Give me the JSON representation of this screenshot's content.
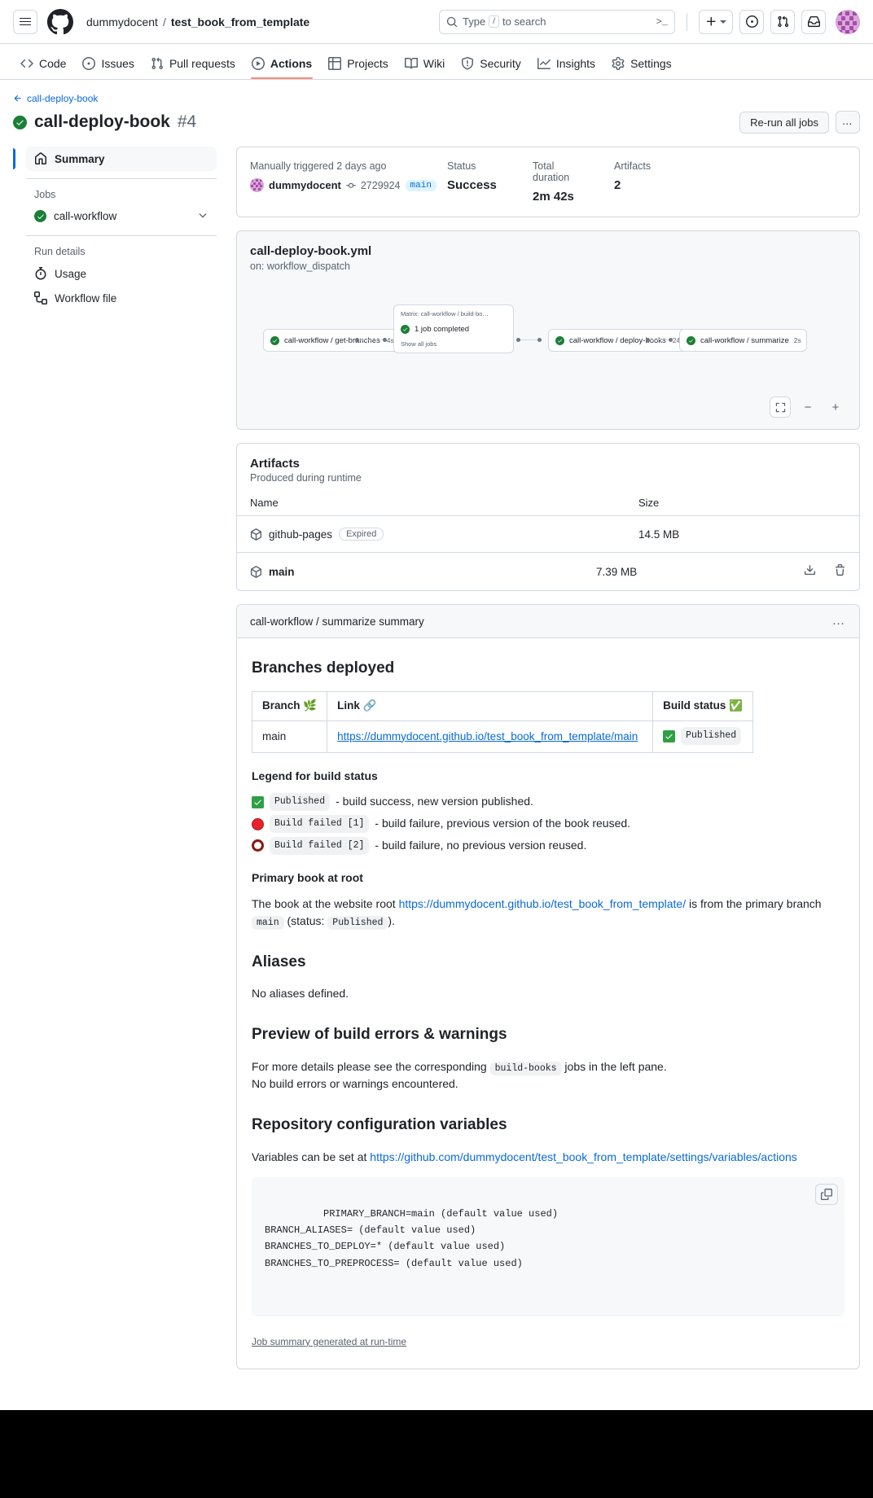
{
  "header": {
    "menu_label": "Open menu",
    "logo_name": "github-logo",
    "owner": "dummydocent",
    "separator": "/",
    "repo": "test_book_from_template",
    "search": {
      "placeholder": "Type",
      "slash_key": "/",
      "placeholder_tail": "to search",
      "command_glyph": ">_"
    },
    "create_label": "+",
    "icons": {
      "issues": "issue-opened-icon",
      "pull_requests": "git-pull-request-icon",
      "inbox": "inbox-icon",
      "avatar": "user-avatar"
    }
  },
  "repo_nav": [
    {
      "label": "Code",
      "icon": "code-icon",
      "active": false
    },
    {
      "label": "Issues",
      "icon": "issue-opened-icon",
      "active": false
    },
    {
      "label": "Pull requests",
      "icon": "git-pull-request-icon",
      "active": false
    },
    {
      "label": "Actions",
      "icon": "play-icon",
      "active": true
    },
    {
      "label": "Projects",
      "icon": "table-icon",
      "active": false
    },
    {
      "label": "Wiki",
      "icon": "book-icon",
      "active": false
    },
    {
      "label": "Security",
      "icon": "shield-icon",
      "active": false
    },
    {
      "label": "Insights",
      "icon": "graph-icon",
      "active": false
    },
    {
      "label": "Settings",
      "icon": "gear-icon",
      "active": false
    }
  ],
  "run": {
    "back_label": "call-deploy-book",
    "title": "call-deploy-book",
    "number": "#4",
    "status_icon": "success-check-icon",
    "rerun_label": "Re-run all jobs",
    "kebab_label": "…"
  },
  "sidebar": {
    "summary_label": "Summary",
    "jobs_label": "Jobs",
    "jobs": [
      {
        "label": "call-workflow",
        "status": "success"
      }
    ],
    "run_details_label": "Run details",
    "details": [
      {
        "label": "Usage",
        "icon": "stopwatch-icon"
      },
      {
        "label": "Workflow file",
        "icon": "workflow-file-icon"
      }
    ]
  },
  "run_meta": {
    "trigger_title": "Manually triggered 2 days ago",
    "trigger_user": "dummydocent",
    "commit_sha": "2729924",
    "branch": "main",
    "status_title": "Status",
    "status_value": "Success",
    "duration_title": "Total duration",
    "duration_value": "2m 42s",
    "artifacts_title": "Artifacts",
    "artifacts_value": "2"
  },
  "graph": {
    "title": "call-deploy-book.yml",
    "subtitle": "on: workflow_dispatch",
    "nodes": [
      {
        "label": "call-workflow / get-branches",
        "duration": "4s"
      },
      {
        "label": "call-workflow / deploy-books",
        "duration": "24s"
      },
      {
        "label": "call-workflow / summarize",
        "duration": "2s"
      }
    ],
    "matrix": {
      "title": "Matrix: call-workflow / build-bo…",
      "row_label": "1 job completed",
      "show_all": "Show all jobs"
    },
    "controls": {
      "fullscreen": "fullscreen-icon",
      "zoom_out": "−",
      "zoom_in": "+"
    }
  },
  "artifacts": {
    "title": "Artifacts",
    "subtitle": "Produced during runtime",
    "columns": {
      "name": "Name",
      "size": "Size"
    },
    "rows": [
      {
        "name": "github-pages",
        "badge": "Expired",
        "size": "14.5 MB",
        "bold": false,
        "actions": false
      },
      {
        "name": "main",
        "badge": "",
        "size": "7.39 MB",
        "bold": true,
        "actions": true
      }
    ],
    "download_icon": "download-icon",
    "delete_icon": "trash-icon"
  },
  "job_summary": {
    "header_title": "call-workflow / summarize summary",
    "kebab": "…",
    "branches_heading": "Branches deployed",
    "table": {
      "columns": [
        "Branch 🌿",
        "Link 🔗",
        "Build status ✅"
      ],
      "rows": [
        {
          "branch": "main",
          "link": "https://dummydocent.github.io/test_book_from_template/main",
          "status_badge": "Published"
        }
      ]
    },
    "legend_heading": "Legend for build status",
    "legend": [
      {
        "icon": "green-check-square",
        "code": "Published",
        "text": "- build success, new version published."
      },
      {
        "icon": "red-circle",
        "code": "Build failed [1]",
        "text": "- build failure, previous version of the book reused."
      },
      {
        "icon": "hollow-red-circle",
        "code": "Build failed [2]",
        "text": "- build failure, no previous version reused."
      }
    ],
    "primary_heading": "Primary book at root",
    "primary_text_1": "The book at the website root",
    "primary_link": "https://dummydocent.github.io/test_book_from_template/",
    "primary_text_2": "is from the primary branch",
    "primary_branch": "main",
    "primary_text_3": "(status:",
    "primary_status": "Published",
    "primary_text_4": ").",
    "aliases_heading": "Aliases",
    "aliases_text": "No aliases defined.",
    "preview_heading": "Preview of build errors & warnings",
    "preview_text_1": "For more details please see the corresponding",
    "preview_code": "build-books",
    "preview_text_2": "jobs in the left pane.",
    "preview_text_3": "No build errors or warnings encountered.",
    "variables_heading": "Repository configuration variables",
    "variables_text": "Variables can be set at",
    "variables_link": "https://github.com/dummydocent/test_book_from_template/settings/variables/actions",
    "variables_code": "PRIMARY_BRANCH=main (default value used)\nBRANCH_ALIASES= (default value used)\nBRANCHES_TO_DEPLOY=* (default value used)\nBRANCHES_TO_PREPROCESS= (default value used)",
    "copy_icon": "copy-icon",
    "footnote": "Job summary generated at run-time"
  }
}
